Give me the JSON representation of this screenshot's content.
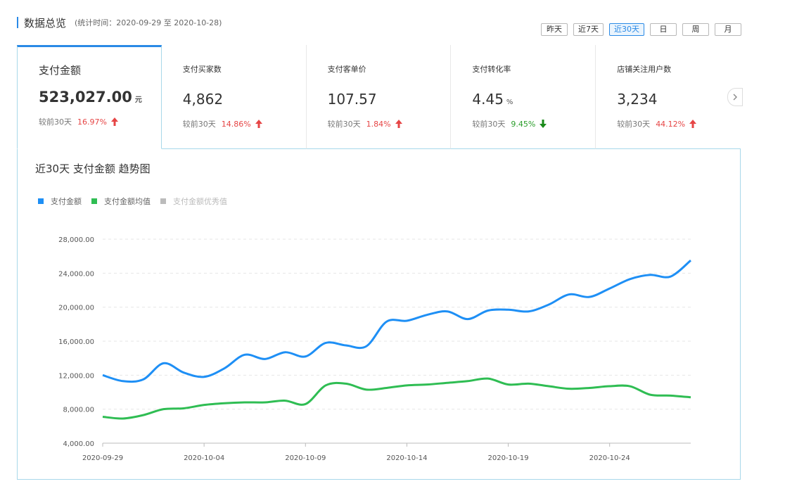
{
  "header": {
    "title": "数据总览",
    "subtitle": "(统计时间：2020-09-29 至 2020-10-28)"
  },
  "ranges": [
    "昨天",
    "近7天",
    "近30天",
    "日",
    "周",
    "月"
  ],
  "active_range": "近30天",
  "cards": [
    {
      "label": "支付金额",
      "value": "523,027.00",
      "unit": "元",
      "cmp_label": "较前30天",
      "pct": "16.97%",
      "trend": "up"
    },
    {
      "label": "支付买家数",
      "value": "4,862",
      "unit": "",
      "cmp_label": "较前30天",
      "pct": "14.86%",
      "trend": "up"
    },
    {
      "label": "支付客单价",
      "value": "107.57",
      "unit": "",
      "cmp_label": "较前30天",
      "pct": "1.84%",
      "trend": "up"
    },
    {
      "label": "支付转化率",
      "value": "4.45",
      "unit": "%",
      "cmp_label": "较前30天",
      "pct": "9.45%",
      "trend": "down"
    },
    {
      "label": "店铺关注用户数",
      "value": "3,234",
      "unit": "",
      "cmp_label": "较前30天",
      "pct": "44.12%",
      "trend": "up"
    }
  ],
  "chart_title": "近30天 支付金额 趋势图",
  "legend": [
    {
      "label": "支付金额",
      "color": "#1e8ff5",
      "enabled": true
    },
    {
      "label": "支付金额均值",
      "color": "#2fbd53",
      "enabled": true
    },
    {
      "label": "支付金额优秀值",
      "color": "#bbbbbb",
      "enabled": false
    }
  ],
  "chart_data": {
    "type": "line",
    "x": [
      "2020-09-29",
      "2020-09-30",
      "2020-10-01",
      "2020-10-02",
      "2020-10-03",
      "2020-10-04",
      "2020-10-05",
      "2020-10-06",
      "2020-10-07",
      "2020-10-08",
      "2020-10-09",
      "2020-10-10",
      "2020-10-11",
      "2020-10-12",
      "2020-10-13",
      "2020-10-14",
      "2020-10-15",
      "2020-10-16",
      "2020-10-17",
      "2020-10-18",
      "2020-10-19",
      "2020-10-20",
      "2020-10-21",
      "2020-10-22",
      "2020-10-23",
      "2020-10-24",
      "2020-10-25",
      "2020-10-26",
      "2020-10-27",
      "2020-10-28"
    ],
    "x_tick_labels": [
      "2020-09-29",
      "2020-10-04",
      "2020-10-09",
      "2020-10-14",
      "2020-10-19",
      "2020-10-24"
    ],
    "series": [
      {
        "name": "支付金额",
        "color": "#1e8ff5",
        "values": [
          12000,
          11300,
          11500,
          13400,
          12300,
          11800,
          12800,
          14400,
          13900,
          14700,
          14200,
          15800,
          15500,
          15400,
          18300,
          18400,
          19100,
          19500,
          18600,
          19600,
          19700,
          19500,
          20300,
          21500,
          21200,
          22200,
          23300,
          23800,
          23600,
          25500
        ]
      },
      {
        "name": "支付金额均值",
        "color": "#2fbd53",
        "values": [
          7100,
          6900,
          7300,
          8000,
          8100,
          8500,
          8700,
          8800,
          8800,
          9000,
          8600,
          10800,
          11000,
          10300,
          10500,
          10800,
          10900,
          11100,
          11300,
          11600,
          10900,
          11000,
          10700,
          10400,
          10500,
          10700,
          10700,
          9700,
          9600,
          9400
        ]
      }
    ],
    "y_ticks": [
      4000,
      8000,
      12000,
      16000,
      20000,
      24000,
      28000
    ],
    "y_tick_labels": [
      "4,000.00",
      "8,000.00",
      "12,000.00",
      "16,000.00",
      "20,000.00",
      "24,000.00",
      "28,000.00"
    ],
    "ylim": [
      4000,
      28000
    ],
    "grid": true
  }
}
